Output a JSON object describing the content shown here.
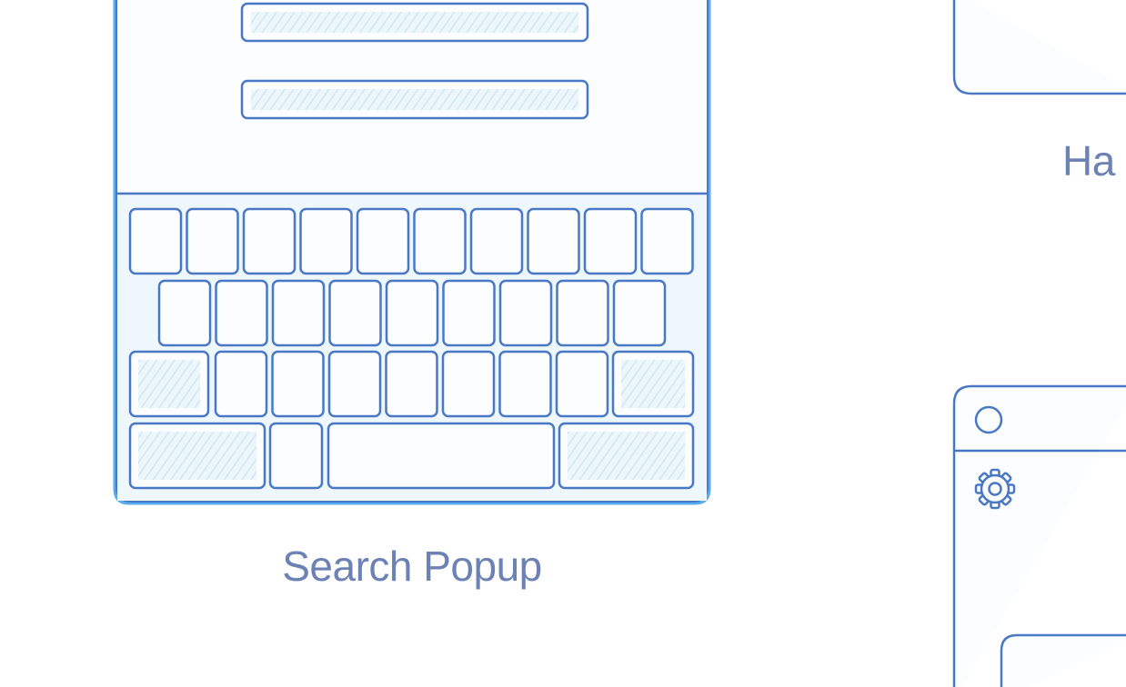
{
  "captions": {
    "search_popup": "Search Popup",
    "partial_label": "Ha"
  },
  "icons": {
    "settings": "gear-icon",
    "window_dot": "circle-icon"
  },
  "colors": {
    "stroke": "#4a78c4",
    "frame_highlight": "#5aacef",
    "fill": "#fbfdfe",
    "hatch": "#cfe7f3",
    "hatch_bg": "#edf7fb",
    "caption": "#6d82b4"
  },
  "keyboard": {
    "row_key_counts": [
      10,
      9,
      9,
      4
    ]
  }
}
